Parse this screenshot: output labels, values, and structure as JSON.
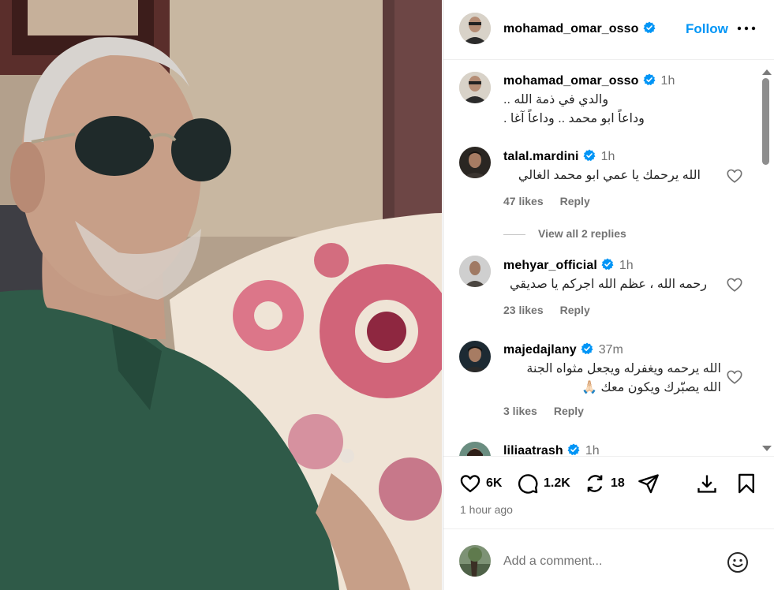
{
  "post": {
    "author": "mohamad_omar_osso",
    "follow_label": "Follow",
    "caption_time": "1h",
    "caption_line1": "والدي في ذمة الله ..",
    "caption_line2": "وداعاً ابو محمد .. وداعاً آغا ."
  },
  "comments": [
    {
      "user": "talal.mardini",
      "time": "1h",
      "text": "الله يرحمك يا عمي ابو محمد الغالي",
      "likes": "47 likes",
      "reply": "Reply"
    },
    {
      "user": "mehyar_official",
      "time": "1h",
      "text": "رحمه الله ، عظم الله اجركم يا صديقي",
      "likes": "23 likes",
      "reply": "Reply"
    },
    {
      "user": "majedajlany",
      "time": "37m",
      "text_line1": "الله يرحمه ويغفرله ويجعل مثواه الجنة",
      "text_line2": "الله يصبّرك ويكون معك 🙏🏻",
      "likes": "3 likes",
      "reply": "Reply"
    },
    {
      "user": "liliaatrash",
      "time": "1h"
    }
  ],
  "view_replies": "View all 2 replies",
  "actions": {
    "likes": "6K",
    "comments": "1.2K",
    "reposts": "18"
  },
  "posted_ago": "1 hour ago",
  "add_comment": {
    "placeholder": "Add a comment..."
  },
  "colors": {
    "accent": "#0095f6",
    "verified": "#0095f6",
    "secondary_text": "#737373"
  }
}
